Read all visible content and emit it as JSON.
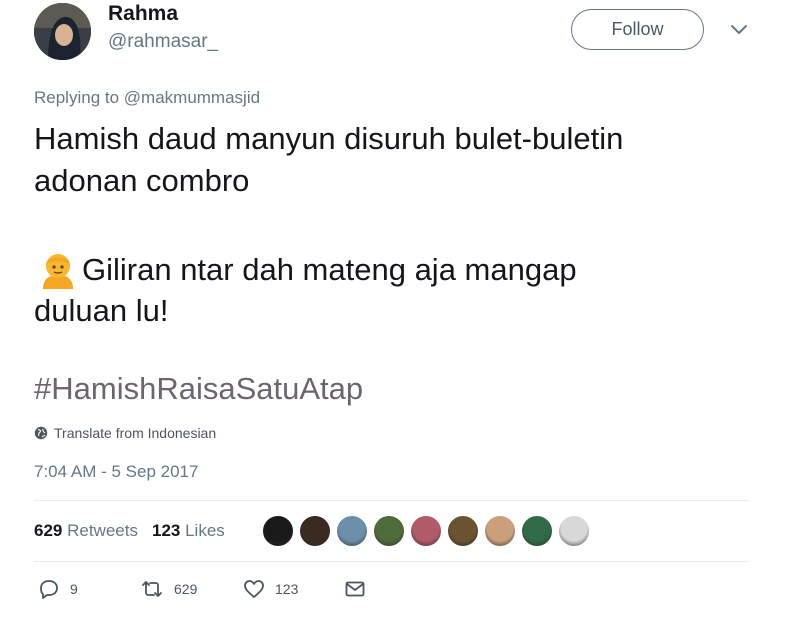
{
  "user": {
    "display_name": "Rahma",
    "handle": "@rahmasar_",
    "follow_label": "Follow"
  },
  "reply_context": {
    "prefix": "Replying to ",
    "mention": "@makmummasjid"
  },
  "tweet": {
    "line1": "Hamish daud manyun disuruh bulet-buletin",
    "line2": "adonan combro",
    "line3": "Giliran ntar dah mateng aja mangap",
    "line4": "duluan lu!",
    "hashtag": "#HamishRaisaSatuAtap"
  },
  "translate_label": "Translate from Indonesian",
  "timestamp": "7:04 AM - 5 Sep 2017",
  "stats": {
    "retweets_count": "629",
    "retweets_label": "Retweets",
    "likes_count": "123",
    "likes_label": "Likes"
  },
  "likers": [
    "#1a1a1a",
    "#3b2a22",
    "#6d8ea8",
    "#4e6b3a",
    "#b05a6a",
    "#6b5230",
    "#c9a07a",
    "#2f6b46",
    "#d8d8d8"
  ],
  "actions": {
    "reply_count": "9",
    "retweet_count": "629",
    "like_count": "123"
  },
  "icons": {
    "caret": "chevron-down-icon",
    "globe": "globe-icon",
    "reply": "reply-icon",
    "retweet": "retweet-icon",
    "like": "heart-icon",
    "dm": "envelope-icon"
  }
}
